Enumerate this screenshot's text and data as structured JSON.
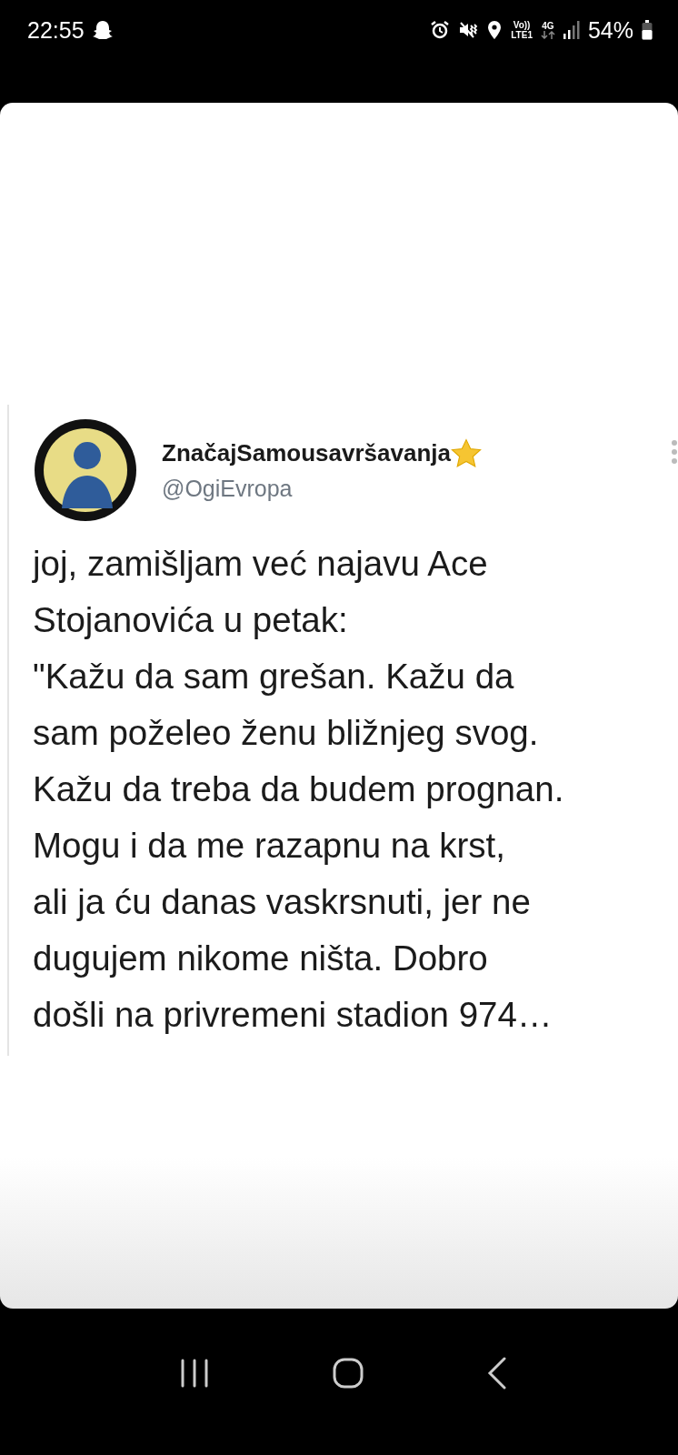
{
  "status_bar": {
    "time": "22:55",
    "volte": "Vo))",
    "lte": "LTE1",
    "network": "4G",
    "battery": "54%"
  },
  "post": {
    "name": "ZnačajSamousavršavanja",
    "handle": "@OgiEvropa",
    "lines": [
      "joj, zamišljam već najavu Ace",
      "Stojanovića u petak:",
      "\"Kažu da sam grešan. Kažu da",
      "sam poželeo ženu bližnjeg svog.",
      "Kažu da treba da budem prognan.",
      "Mogu i da me razapnu na krst,",
      "ali ja ću danas vaskrsnuti, jer ne",
      "dugujem nikome ništa. Dobro",
      "došli na privremeni stadion 974…"
    ]
  }
}
